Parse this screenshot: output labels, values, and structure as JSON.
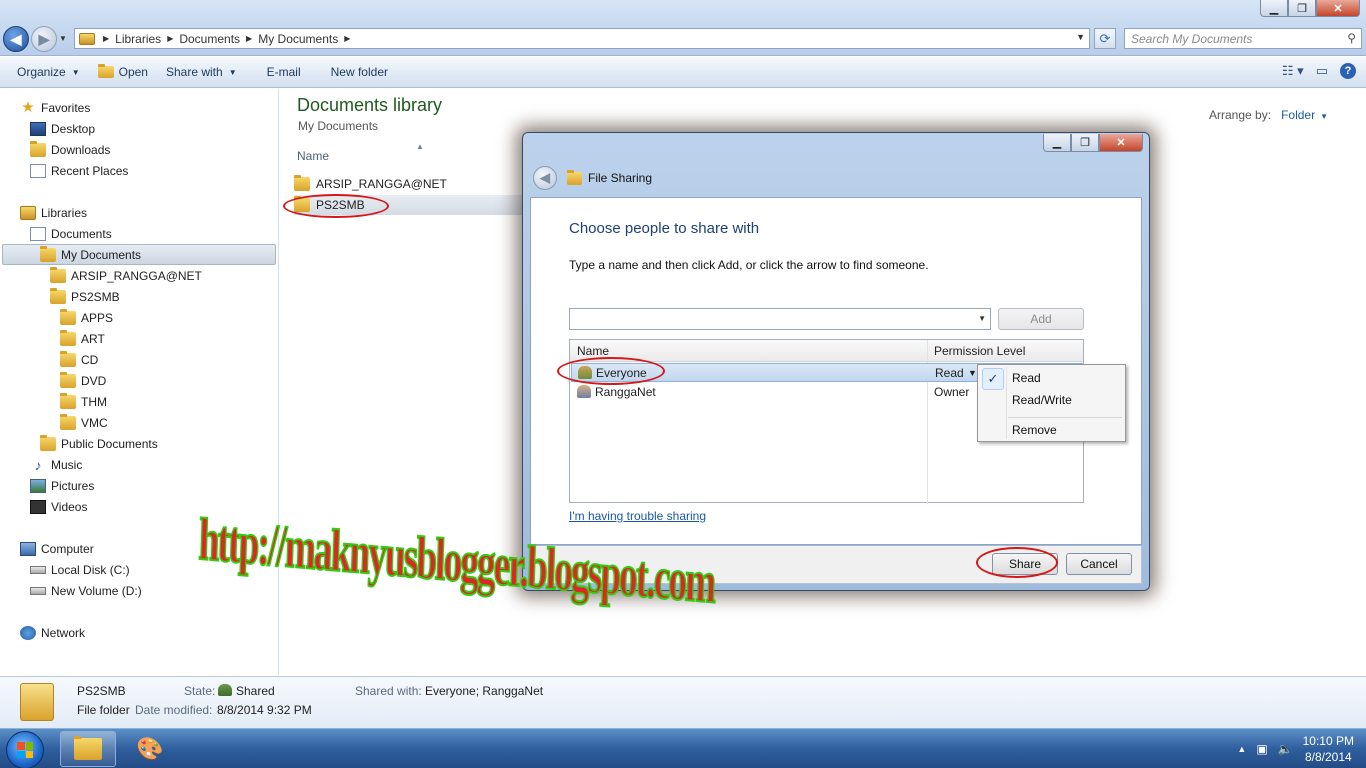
{
  "explorer": {
    "breadcrumb": [
      "Libraries",
      "Documents",
      "My Documents"
    ],
    "search_placeholder": "Search My Documents",
    "toolbar": {
      "organize": "Organize",
      "open": "Open",
      "share_with": "Share with",
      "email": "E-mail",
      "new_folder": "New folder"
    }
  },
  "nav": {
    "favorites": "Favorites",
    "desktop": "Desktop",
    "downloads": "Downloads",
    "recent": "Recent Places",
    "libraries": "Libraries",
    "documents": "Documents",
    "my_documents": "My Documents",
    "arsip": "ARSIP_RANGGA@NET",
    "ps2smb": "PS2SMB",
    "apps": "APPS",
    "art": "ART",
    "cd": "CD",
    "dvd": "DVD",
    "thm": "THM",
    "vmc": "VMC",
    "public_documents": "Public Documents",
    "music": "Music",
    "pictures": "Pictures",
    "videos": "Videos",
    "computer": "Computer",
    "local_disk": "Local Disk (C:)",
    "new_volume": "New Volume (D:)",
    "network": "Network"
  },
  "content": {
    "title": "Documents library",
    "subtitle": "My Documents",
    "arrange_label": "Arrange by:",
    "arrange_value": "Folder",
    "column_name": "Name",
    "files": [
      "ARSIP_RANGGA@NET",
      "PS2SMB"
    ]
  },
  "details": {
    "name": "PS2SMB",
    "type": "File folder",
    "state_label": "State:",
    "state_value": "Shared",
    "date_label": "Date modified:",
    "date_value": "8/8/2014 9:32 PM",
    "shared_label": "Shared with:",
    "shared_value": "Everyone; RanggaNet"
  },
  "dialog": {
    "title": "File Sharing",
    "heading": "Choose people to share with",
    "instruction": "Type a name and then click Add, or click the arrow to find someone.",
    "add_button": "Add",
    "col_name": "Name",
    "col_permission": "Permission Level",
    "rows": [
      {
        "name": "Everyone",
        "permission": "Read"
      },
      {
        "name": "RanggaNet",
        "permission": "Owner"
      }
    ],
    "trouble_link": "I'm having trouble sharing",
    "share_button": "Share",
    "cancel_button": "Cancel"
  },
  "permission_menu": {
    "read": "Read",
    "read_write": "Read/Write",
    "remove": "Remove",
    "checked": "Read"
  },
  "taskbar": {
    "time": "10:10 PM",
    "date": "8/8/2014"
  },
  "watermark": "http://maknyusblogger.blogspot.com",
  "colors": {
    "annotation_ring": "#d51818",
    "library_title": "#1e5a1e",
    "dialog_heading": "#1f3f78"
  }
}
